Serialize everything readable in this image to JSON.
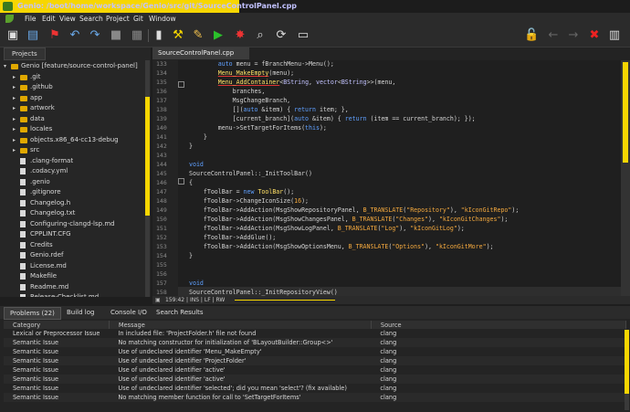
{
  "window": {
    "title": "Genio: /boot/home/workspace/Genio/src/git/SourceControlPanel.cpp"
  },
  "menu": [
    "File",
    "Edit",
    "View",
    "Search",
    "Project",
    "Git",
    "Window"
  ],
  "left_panel": {
    "tab": "Projects",
    "tree": [
      {
        "label": "Genio [feature/source-control-panel]",
        "kind": "root"
      },
      {
        "label": ".git",
        "kind": "folder"
      },
      {
        "label": ".github",
        "kind": "folder"
      },
      {
        "label": "app",
        "kind": "folder"
      },
      {
        "label": "artwork",
        "kind": "folder"
      },
      {
        "label": "data",
        "kind": "folder"
      },
      {
        "label": "locales",
        "kind": "folder"
      },
      {
        "label": "objects.x86_64-cc13-debug",
        "kind": "folder"
      },
      {
        "label": "src",
        "kind": "folder"
      },
      {
        "label": ".clang-format",
        "kind": "file"
      },
      {
        "label": ".codacy.yml",
        "kind": "file"
      },
      {
        "label": ".genio",
        "kind": "file"
      },
      {
        "label": ".gitignore",
        "kind": "file"
      },
      {
        "label": "Changelog.h",
        "kind": "file"
      },
      {
        "label": "Changelog.txt",
        "kind": "file"
      },
      {
        "label": "Configuring-clangd-lsp.md",
        "kind": "file"
      },
      {
        "label": "CPPLINT.CFG",
        "kind": "file"
      },
      {
        "label": "Credits",
        "kind": "file"
      },
      {
        "label": "Genio.rdef",
        "kind": "file"
      },
      {
        "label": "License.md",
        "kind": "file"
      },
      {
        "label": "Makefile",
        "kind": "file"
      },
      {
        "label": "Readme.md",
        "kind": "file"
      },
      {
        "label": "Release-Checklist.md",
        "kind": "file"
      }
    ]
  },
  "editor": {
    "tab": "SourceControlPanel.cpp",
    "status": "159:42 | INS | LF | RW",
    "line_numbers": [
      "133",
      "134",
      "135",
      "136",
      "137",
      "138",
      "139",
      "140",
      "141",
      "142",
      "143",
      "144",
      "145",
      "146",
      "147",
      "148",
      "149",
      "150",
      "151",
      "152",
      "153",
      "154",
      "155",
      "156",
      "157",
      "158",
      "159"
    ]
  },
  "bottom": {
    "tabs": [
      "Problems (22)",
      "Build log",
      "Console I/O",
      "Search Results"
    ],
    "columns": [
      "Category",
      "Message",
      "Source"
    ],
    "rows": [
      [
        "Lexical or Preprocessor Issue",
        "In included file: 'ProjectFolder.h' file not found",
        "clang"
      ],
      [
        "Semantic Issue",
        "No matching constructor for initialization of 'BLayoutBuilder::Group<>'",
        "clang"
      ],
      [
        "Semantic Issue",
        "Use of undeclared identifier 'Menu_MakeEmpty'",
        "clang"
      ],
      [
        "Semantic Issue",
        "Use of undeclared identifier 'ProjectFolder'",
        "clang"
      ],
      [
        "Semantic Issue",
        "Use of undeclared identifier 'active'",
        "clang"
      ],
      [
        "Semantic Issue",
        "Use of undeclared identifier 'active'",
        "clang"
      ],
      [
        "Semantic Issue",
        "Use of undeclared identifier 'selected'; did you mean 'select'? (fix available)",
        "clang"
      ],
      [
        "Semantic Issue",
        "No matching member function for call to 'SetTargetForItems'",
        "clang"
      ]
    ]
  },
  "colors": {
    "accent": "#f7d600"
  }
}
